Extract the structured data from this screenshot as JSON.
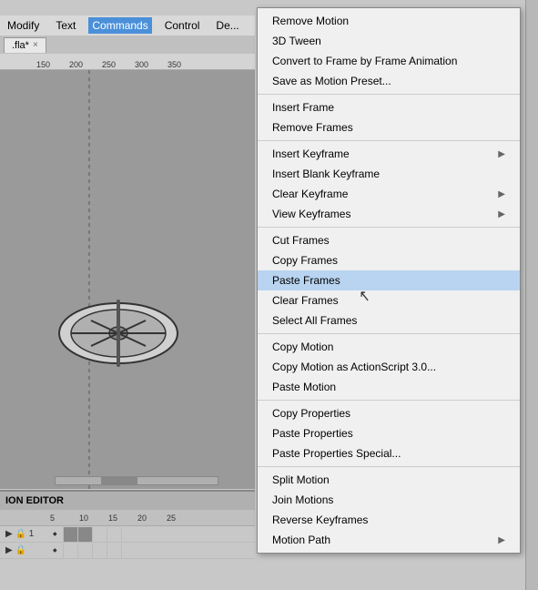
{
  "menubar": {
    "items": [
      "Modify",
      "Text",
      "Commands",
      "Control",
      "De..."
    ]
  },
  "tab": {
    "label": ".fla*",
    "close": "×"
  },
  "ruler": {
    "marks": [
      "150",
      "200",
      "250",
      "300",
      "350"
    ]
  },
  "timeline": {
    "header": "ION EDITOR",
    "numbers": [
      "5",
      "10",
      "15",
      "20",
      "25"
    ]
  },
  "contextMenu": {
    "sections": [
      {
        "items": [
          {
            "label": "Remove Motion",
            "disabled": false,
            "arrow": false
          },
          {
            "label": "3D Tween",
            "disabled": false,
            "arrow": false
          },
          {
            "label": "Convert to Frame by Frame Animation",
            "disabled": false,
            "arrow": false
          },
          {
            "label": "Save as Motion Preset...",
            "disabled": false,
            "arrow": false
          }
        ]
      },
      {
        "items": [
          {
            "label": "Insert Frame",
            "disabled": false,
            "arrow": false
          },
          {
            "label": "Remove Frames",
            "disabled": false,
            "arrow": false
          }
        ]
      },
      {
        "items": [
          {
            "label": "Insert Keyframe",
            "disabled": false,
            "arrow": true
          },
          {
            "label": "Insert Blank Keyframe",
            "disabled": false,
            "arrow": false
          },
          {
            "label": "Clear Keyframe",
            "disabled": false,
            "arrow": true
          },
          {
            "label": "View Keyframes",
            "disabled": false,
            "arrow": true
          }
        ]
      },
      {
        "items": [
          {
            "label": "Cut Frames",
            "disabled": false,
            "arrow": false
          },
          {
            "label": "Copy Frames",
            "disabled": false,
            "arrow": false
          },
          {
            "label": "Paste Frames",
            "disabled": false,
            "arrow": false,
            "highlighted": true
          },
          {
            "label": "Clear Frames",
            "disabled": false,
            "arrow": false
          },
          {
            "label": "Select All Frames",
            "disabled": false,
            "arrow": false
          }
        ]
      },
      {
        "items": [
          {
            "label": "Copy Motion",
            "disabled": false,
            "arrow": false
          },
          {
            "label": "Copy Motion as ActionScript 3.0...",
            "disabled": false,
            "arrow": false
          },
          {
            "label": "Paste Motion",
            "disabled": false,
            "arrow": false
          }
        ]
      },
      {
        "items": [
          {
            "label": "Copy Properties",
            "disabled": false,
            "arrow": false
          },
          {
            "label": "Paste Properties",
            "disabled": false,
            "arrow": false
          },
          {
            "label": "Paste Properties Special...",
            "disabled": false,
            "arrow": false
          }
        ]
      },
      {
        "items": [
          {
            "label": "Split Motion",
            "disabled": false,
            "arrow": false
          },
          {
            "label": "Join Motions",
            "disabled": false,
            "arrow": false
          },
          {
            "label": "Reverse Keyframes",
            "disabled": false,
            "arrow": false
          },
          {
            "label": "Motion Path",
            "disabled": false,
            "arrow": true
          }
        ]
      }
    ]
  }
}
